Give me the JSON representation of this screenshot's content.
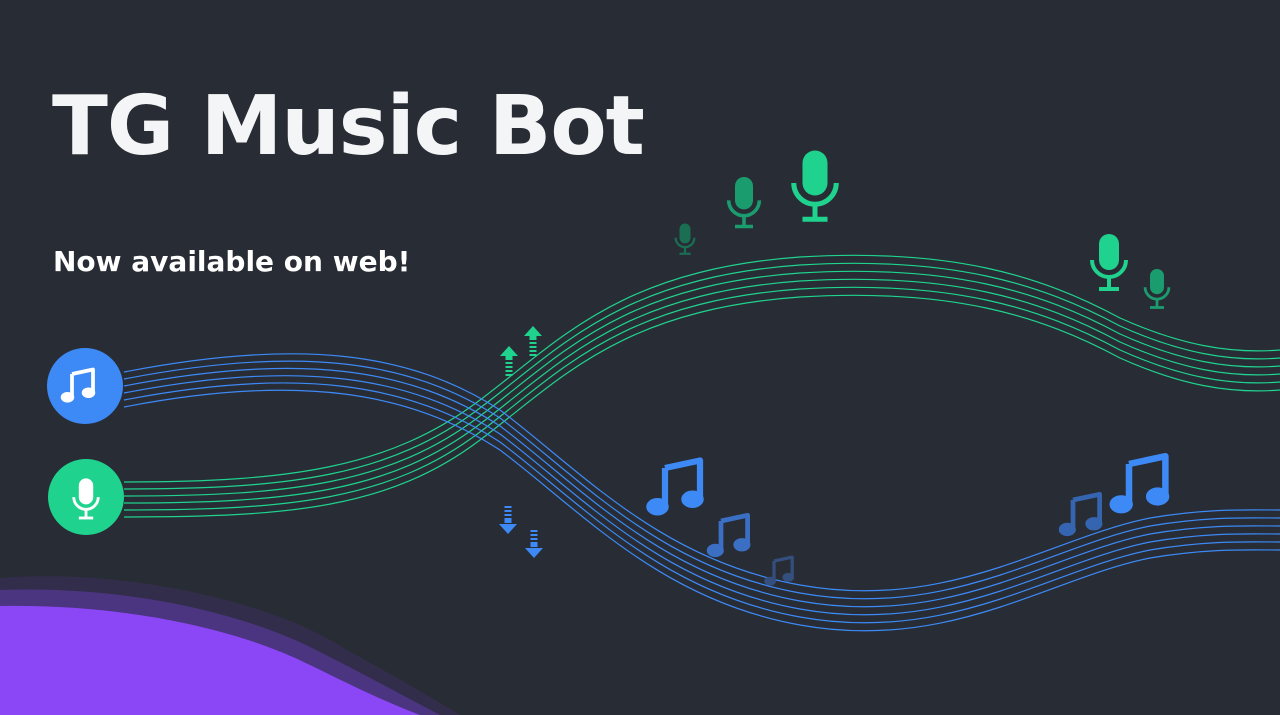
{
  "hero": {
    "title": "TG Music Bot",
    "subtitle": "Now available on web!"
  },
  "colors": {
    "background": "#282c34",
    "title_text": "#f4f5f7",
    "music_blue": "#3d8af7",
    "voice_green": "#1fd38e",
    "wave_purple": "#8b47f5"
  },
  "icons": {
    "music_circle": "music-note-icon",
    "voice_circle": "microphone-icon",
    "upload": "arrow-up-icon",
    "download": "arrow-down-icon"
  }
}
